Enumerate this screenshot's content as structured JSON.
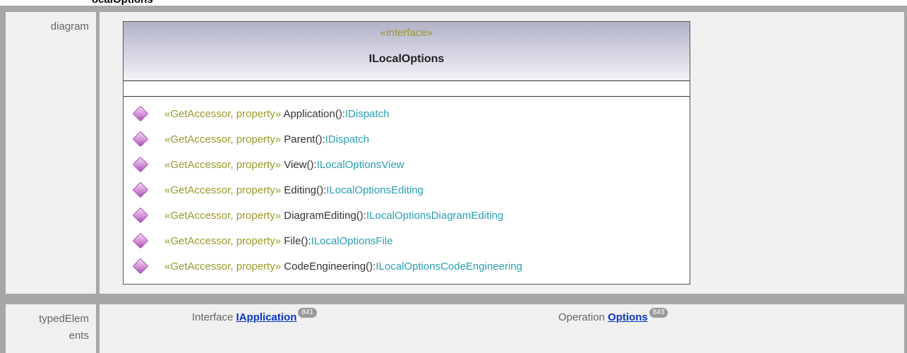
{
  "page": {
    "top_title": "ocalOptions"
  },
  "rows": {
    "diagram_label": "diagram",
    "typed_label_line1": "typedElem",
    "typed_label_line2": "ents"
  },
  "uml_class": {
    "stereotype": "«interface»",
    "name": "ILocalOptions",
    "operations": [
      {
        "stereotype": "«GetAccessor, property»",
        "name": "Application():",
        "type": "IDispatch"
      },
      {
        "stereotype": "«GetAccessor, property»",
        "name": "Parent():",
        "type": "IDispatch"
      },
      {
        "stereotype": "«GetAccessor, property»",
        "name": "View():",
        "type": "ILocalOptionsView"
      },
      {
        "stereotype": "«GetAccessor, property»",
        "name": "Editing():",
        "type": "ILocalOptionsEditing"
      },
      {
        "stereotype": "«GetAccessor, property»",
        "name": "DiagramEditing():",
        "type": "ILocalOptionsDiagramEditing"
      },
      {
        "stereotype": "«GetAccessor, property»",
        "name": "File():",
        "type": "ILocalOptionsFile"
      },
      {
        "stereotype": "«GetAccessor, property»",
        "name": "CodeEngineering():",
        "type": "ILocalOptionsCodeEngineering"
      }
    ]
  },
  "typed_elements": [
    {
      "kind": "Interface",
      "link": "IApplication",
      "badge": "841"
    },
    {
      "kind": "Operation",
      "link": "Options",
      "badge": "843"
    }
  ],
  "colors": {
    "stereotype": "#9a9a2c",
    "type": "#2a9fb0",
    "link": "#0b34c5",
    "border": "#a7a7a7",
    "cell_bg": "#f0f0f0"
  }
}
